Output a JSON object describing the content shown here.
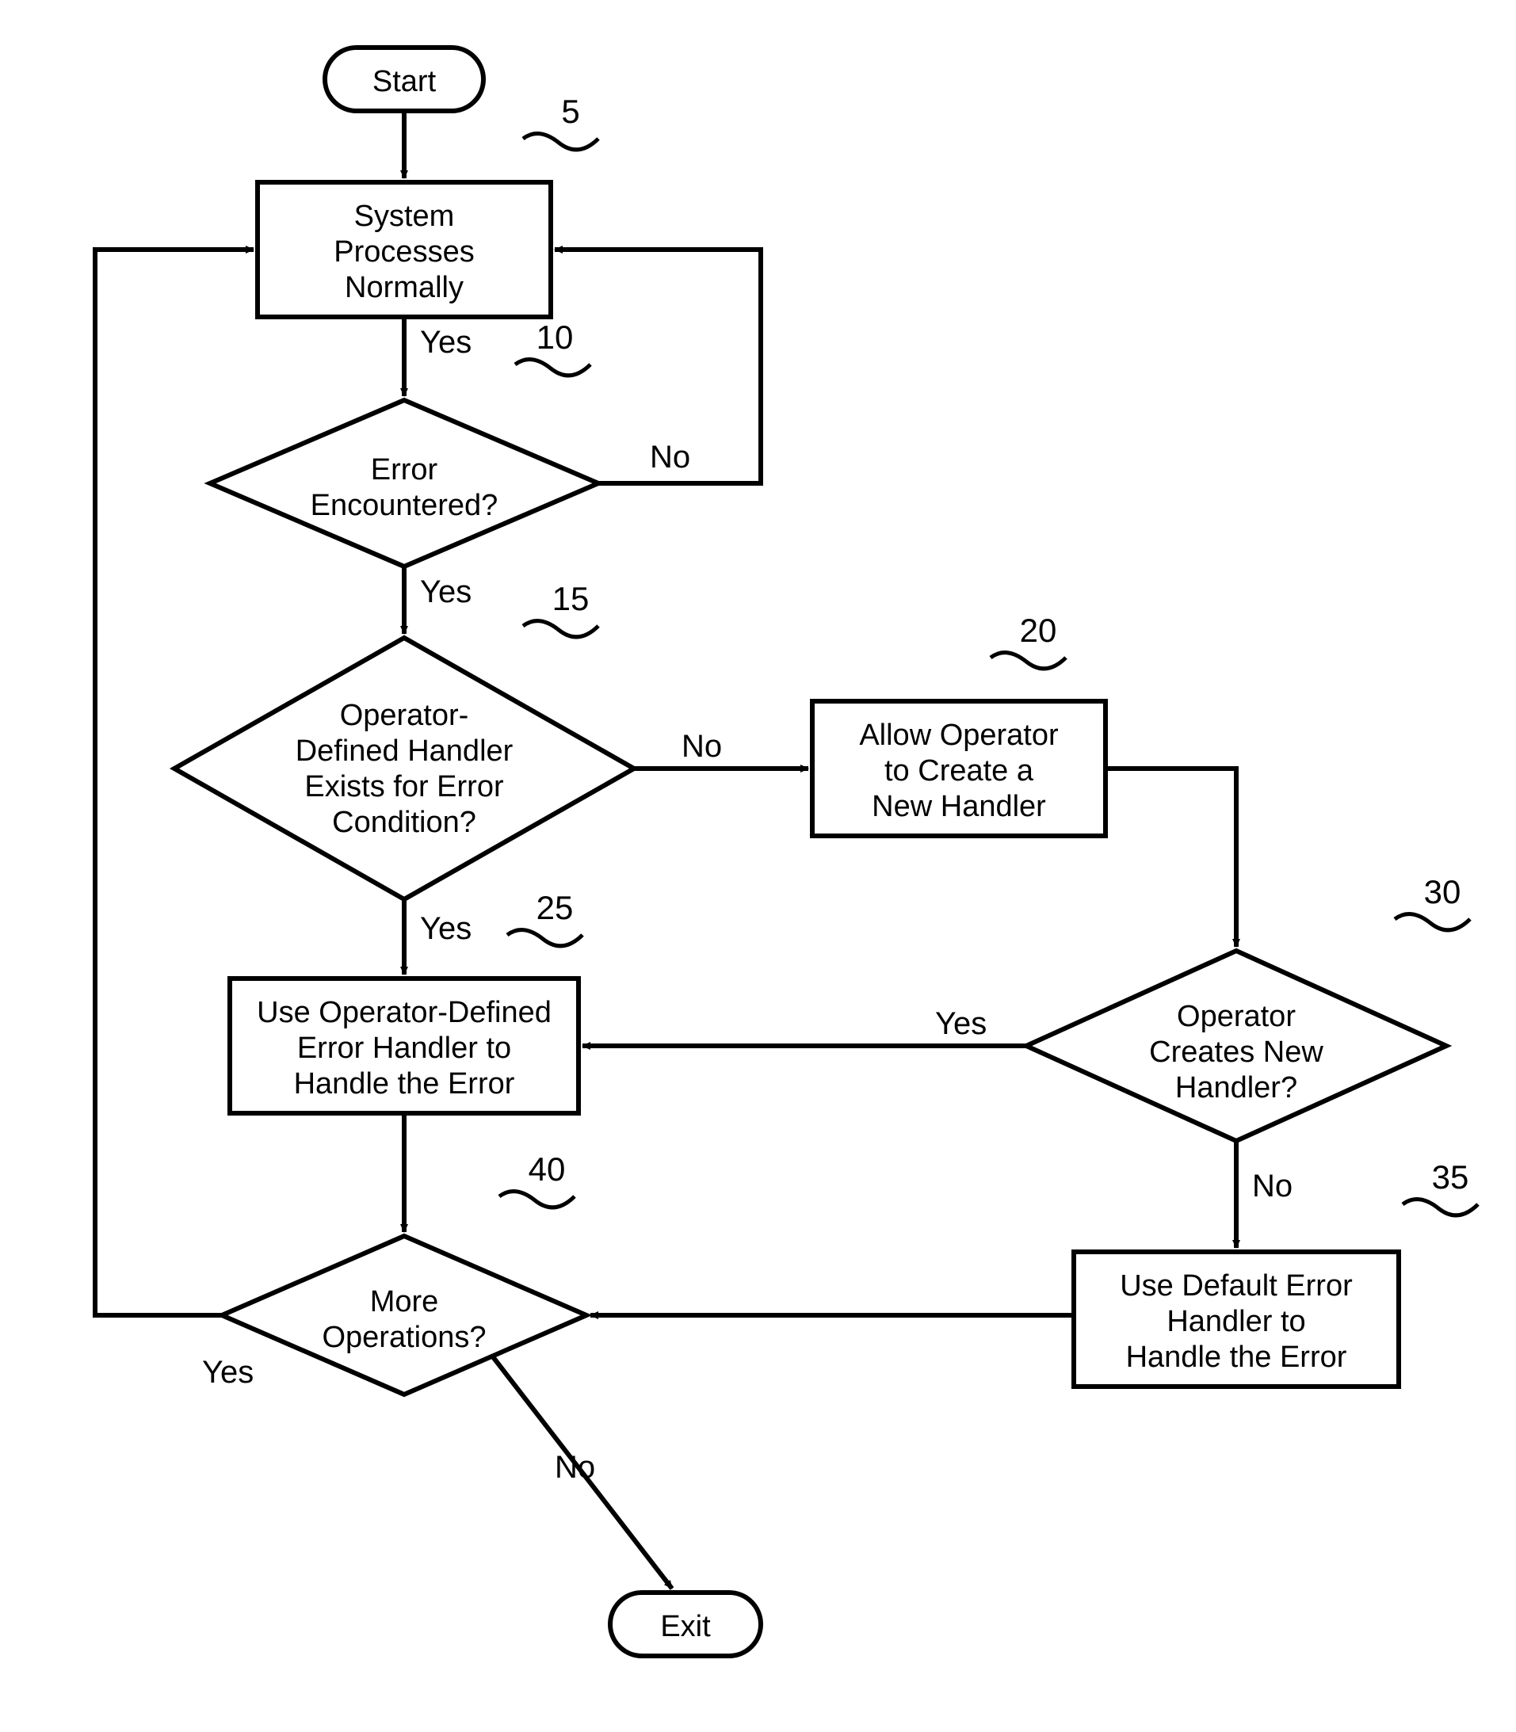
{
  "chart_data": {
    "type": "flowchart",
    "nodes": [
      {
        "id": "start",
        "type": "terminal",
        "label": "Start"
      },
      {
        "id": "n5",
        "ref": "5",
        "type": "process",
        "lines": [
          "System",
          "Processes",
          "Normally"
        ]
      },
      {
        "id": "n10",
        "ref": "10",
        "type": "decision",
        "lines": [
          "Error",
          "Encountered?"
        ]
      },
      {
        "id": "n15",
        "ref": "15",
        "type": "decision",
        "lines": [
          "Operator-",
          "Defined Handler",
          "Exists for Error",
          "Condition?"
        ]
      },
      {
        "id": "n20",
        "ref": "20",
        "type": "process",
        "lines": [
          "Allow  Operator",
          "to Create a",
          "New Handler"
        ]
      },
      {
        "id": "n25",
        "ref": "25",
        "type": "process",
        "lines": [
          "Use Operator-Defined",
          "Error Handler to",
          "Handle the Error"
        ]
      },
      {
        "id": "n30",
        "ref": "30",
        "type": "decision",
        "lines": [
          "Operator",
          "Creates New",
          "Handler?"
        ]
      },
      {
        "id": "n35",
        "ref": "35",
        "type": "process",
        "lines": [
          "Use Default Error",
          "Handler to",
          "Handle the Error"
        ]
      },
      {
        "id": "n40",
        "ref": "40",
        "type": "decision",
        "lines": [
          "More",
          "Operations?"
        ]
      },
      {
        "id": "exit",
        "type": "terminal",
        "label": "Exit"
      }
    ],
    "edges": [
      {
        "from": "start",
        "to": "n5",
        "label": ""
      },
      {
        "from": "n5",
        "to": "n10",
        "label": "Yes"
      },
      {
        "from": "n10",
        "to": "n5",
        "label": "No"
      },
      {
        "from": "n10",
        "to": "n15",
        "label": "Yes"
      },
      {
        "from": "n15",
        "to": "n20",
        "label": "No"
      },
      {
        "from": "n15",
        "to": "n25",
        "label": "Yes"
      },
      {
        "from": "n20",
        "to": "n30",
        "label": ""
      },
      {
        "from": "n30",
        "to": "n25",
        "label": "Yes"
      },
      {
        "from": "n30",
        "to": "n35",
        "label": "No"
      },
      {
        "from": "n25",
        "to": "n40",
        "label": ""
      },
      {
        "from": "n35",
        "to": "n40",
        "label": ""
      },
      {
        "from": "n40",
        "to": "n5",
        "label": "Yes"
      },
      {
        "from": "n40",
        "to": "exit",
        "label": "No"
      }
    ]
  },
  "labels": {
    "start": "Start",
    "exit": "Exit",
    "yes": "Yes",
    "no": "No",
    "ref5": "5",
    "ref10": "10",
    "ref15": "15",
    "ref20": "20",
    "ref25": "25",
    "ref30": "30",
    "ref35": "35",
    "ref40": "40",
    "n5l1": "System",
    "n5l2": "Processes",
    "n5l3": "Normally",
    "n10l1": "Error",
    "n10l2": "Encountered?",
    "n15l1": "Operator-",
    "n15l2": "Defined Handler",
    "n15l3": "Exists for Error",
    "n15l4": "Condition?",
    "n20l1": "Allow  Operator",
    "n20l2": "to Create a",
    "n20l3": "New Handler",
    "n25l1": "Use Operator-Defined",
    "n25l2": "Error Handler to",
    "n25l3": "Handle the Error",
    "n30l1": "Operator",
    "n30l2": "Creates New",
    "n30l3": "Handler?",
    "n35l1": "Use Default Error",
    "n35l2": "Handler to",
    "n35l3": "Handle the Error",
    "n40l1": "More",
    "n40l2": "Operations?"
  }
}
